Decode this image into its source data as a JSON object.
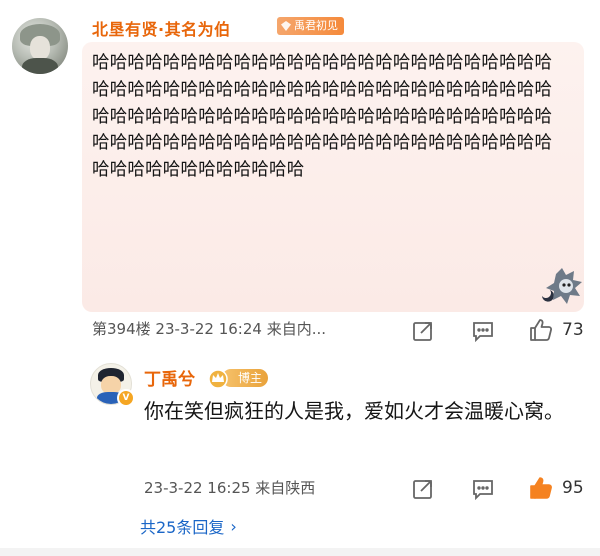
{
  "comment": {
    "author": "北垦有贤·其名为伯",
    "badge": "禹君初见",
    "text": "哈哈哈哈哈哈哈哈哈哈哈哈哈哈哈哈哈哈哈哈哈哈哈哈哈哈哈哈哈哈哈哈哈哈哈哈哈哈哈哈哈哈哈哈哈哈哈哈哈哈哈哈哈哈哈哈哈哈哈哈哈哈哈哈哈哈哈哈哈哈哈哈哈哈哈哈哈哈哈哈哈哈哈哈哈哈哈哈哈哈哈哈哈哈哈哈哈哈哈哈哈哈哈哈哈哈哈哈哈哈哈哈哈哈哈哈",
    "meta": "第394楼  23-3-22 16:24  来自内...",
    "likes": "73"
  },
  "reply": {
    "author": "丁禹兮",
    "badge": "博主",
    "text": "你在笑但疯狂的人是我，爱如火才会温暖心窝。",
    "meta": "23-3-22 16:25  来自陕西",
    "likes": "95"
  },
  "footer": {
    "expand_label": "共25条回复"
  },
  "colors": {
    "name": "#e8660a",
    "link": "#1a66c7",
    "liked": "#f58220",
    "bubble": "#fbece8"
  },
  "icons": [
    "share-icon",
    "comment-icon",
    "like-icon",
    "like-filled-icon",
    "chevron-right-icon",
    "verified-icon",
    "crown-icon",
    "diamond-icon"
  ]
}
